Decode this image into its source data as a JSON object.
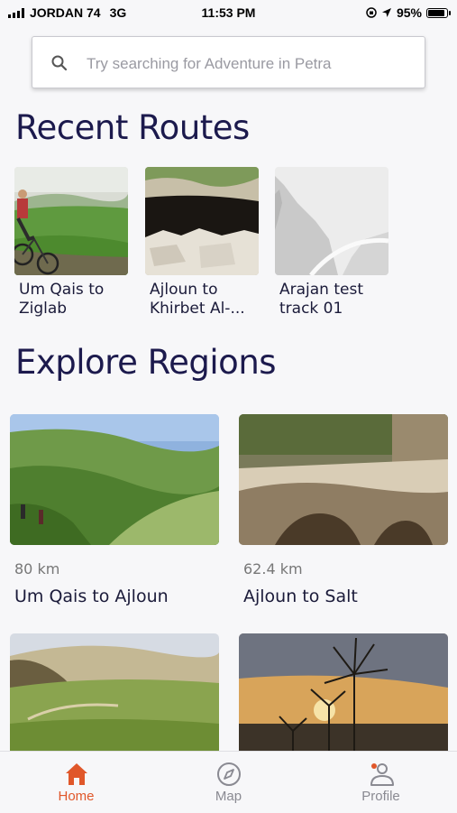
{
  "status_bar": {
    "carrier": "JORDAN 74",
    "network": "3G",
    "time": "11:53 PM",
    "battery": "95%",
    "battery_level": 0.95
  },
  "search": {
    "placeholder": "Try searching for Adventure in Petra",
    "value": ""
  },
  "recent_routes": {
    "title": "Recent Routes",
    "items": [
      {
        "label": "Um Qais to Ziglab",
        "image": "cyclist-green-valley-photo"
      },
      {
        "label": "Ajloun to Khirbet Al-...",
        "image": "cave-entrance-photo"
      },
      {
        "label": "Arajan test track 01",
        "image": "placeholder-landscape-illustration"
      }
    ]
  },
  "explore_regions": {
    "title": "Explore Regions",
    "items": [
      {
        "distance": "80 km",
        "name": "Um Qais to Ajloun",
        "image": "hikers-green-hills-photo"
      },
      {
        "distance": "62.4 km",
        "name": "Ajloun to Salt",
        "image": "stone-ruins-photo"
      },
      {
        "distance": "",
        "name": "",
        "image": "olive-terraces-photo"
      },
      {
        "distance": "",
        "name": "",
        "image": "thistle-sunset-photo"
      }
    ]
  },
  "tab_bar": {
    "tabs": [
      {
        "label": "Home",
        "icon": "home-icon",
        "active": true
      },
      {
        "label": "Map",
        "icon": "compass-icon",
        "active": false
      },
      {
        "label": "Profile",
        "icon": "profile-icon",
        "active": false
      }
    ]
  },
  "colors": {
    "accent": "#e0572a",
    "heading": "#1c1a4d",
    "inactive_tab": "#8a8a92",
    "background": "#f7f7f9"
  }
}
